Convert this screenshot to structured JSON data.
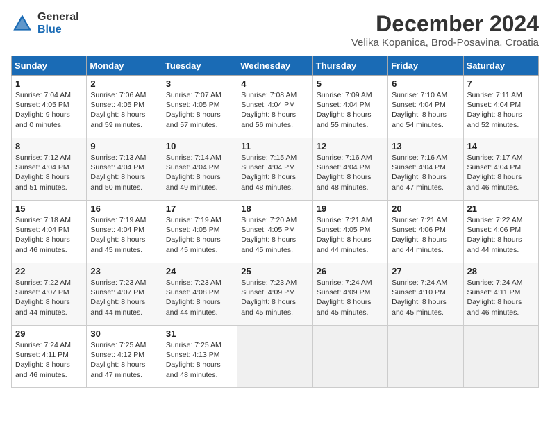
{
  "logo": {
    "general": "General",
    "blue": "Blue"
  },
  "title": "December 2024",
  "subtitle": "Velika Kopanica, Brod-Posavina, Croatia",
  "headers": [
    "Sunday",
    "Monday",
    "Tuesday",
    "Wednesday",
    "Thursday",
    "Friday",
    "Saturday"
  ],
  "weeks": [
    [
      {
        "day": "1",
        "sunrise": "Sunrise: 7:04 AM",
        "sunset": "Sunset: 4:05 PM",
        "daylight": "Daylight: 9 hours and 0 minutes."
      },
      {
        "day": "2",
        "sunrise": "Sunrise: 7:06 AM",
        "sunset": "Sunset: 4:05 PM",
        "daylight": "Daylight: 8 hours and 59 minutes."
      },
      {
        "day": "3",
        "sunrise": "Sunrise: 7:07 AM",
        "sunset": "Sunset: 4:05 PM",
        "daylight": "Daylight: 8 hours and 57 minutes."
      },
      {
        "day": "4",
        "sunrise": "Sunrise: 7:08 AM",
        "sunset": "Sunset: 4:04 PM",
        "daylight": "Daylight: 8 hours and 56 minutes."
      },
      {
        "day": "5",
        "sunrise": "Sunrise: 7:09 AM",
        "sunset": "Sunset: 4:04 PM",
        "daylight": "Daylight: 8 hours and 55 minutes."
      },
      {
        "day": "6",
        "sunrise": "Sunrise: 7:10 AM",
        "sunset": "Sunset: 4:04 PM",
        "daylight": "Daylight: 8 hours and 54 minutes."
      },
      {
        "day": "7",
        "sunrise": "Sunrise: 7:11 AM",
        "sunset": "Sunset: 4:04 PM",
        "daylight": "Daylight: 8 hours and 52 minutes."
      }
    ],
    [
      {
        "day": "8",
        "sunrise": "Sunrise: 7:12 AM",
        "sunset": "Sunset: 4:04 PM",
        "daylight": "Daylight: 8 hours and 51 minutes."
      },
      {
        "day": "9",
        "sunrise": "Sunrise: 7:13 AM",
        "sunset": "Sunset: 4:04 PM",
        "daylight": "Daylight: 8 hours and 50 minutes."
      },
      {
        "day": "10",
        "sunrise": "Sunrise: 7:14 AM",
        "sunset": "Sunset: 4:04 PM",
        "daylight": "Daylight: 8 hours and 49 minutes."
      },
      {
        "day": "11",
        "sunrise": "Sunrise: 7:15 AM",
        "sunset": "Sunset: 4:04 PM",
        "daylight": "Daylight: 8 hours and 48 minutes."
      },
      {
        "day": "12",
        "sunrise": "Sunrise: 7:16 AM",
        "sunset": "Sunset: 4:04 PM",
        "daylight": "Daylight: 8 hours and 48 minutes."
      },
      {
        "day": "13",
        "sunrise": "Sunrise: 7:16 AM",
        "sunset": "Sunset: 4:04 PM",
        "daylight": "Daylight: 8 hours and 47 minutes."
      },
      {
        "day": "14",
        "sunrise": "Sunrise: 7:17 AM",
        "sunset": "Sunset: 4:04 PM",
        "daylight": "Daylight: 8 hours and 46 minutes."
      }
    ],
    [
      {
        "day": "15",
        "sunrise": "Sunrise: 7:18 AM",
        "sunset": "Sunset: 4:04 PM",
        "daylight": "Daylight: 8 hours and 46 minutes."
      },
      {
        "day": "16",
        "sunrise": "Sunrise: 7:19 AM",
        "sunset": "Sunset: 4:04 PM",
        "daylight": "Daylight: 8 hours and 45 minutes."
      },
      {
        "day": "17",
        "sunrise": "Sunrise: 7:19 AM",
        "sunset": "Sunset: 4:05 PM",
        "daylight": "Daylight: 8 hours and 45 minutes."
      },
      {
        "day": "18",
        "sunrise": "Sunrise: 7:20 AM",
        "sunset": "Sunset: 4:05 PM",
        "daylight": "Daylight: 8 hours and 45 minutes."
      },
      {
        "day": "19",
        "sunrise": "Sunrise: 7:21 AM",
        "sunset": "Sunset: 4:05 PM",
        "daylight": "Daylight: 8 hours and 44 minutes."
      },
      {
        "day": "20",
        "sunrise": "Sunrise: 7:21 AM",
        "sunset": "Sunset: 4:06 PM",
        "daylight": "Daylight: 8 hours and 44 minutes."
      },
      {
        "day": "21",
        "sunrise": "Sunrise: 7:22 AM",
        "sunset": "Sunset: 4:06 PM",
        "daylight": "Daylight: 8 hours and 44 minutes."
      }
    ],
    [
      {
        "day": "22",
        "sunrise": "Sunrise: 7:22 AM",
        "sunset": "Sunset: 4:07 PM",
        "daylight": "Daylight: 8 hours and 44 minutes."
      },
      {
        "day": "23",
        "sunrise": "Sunrise: 7:23 AM",
        "sunset": "Sunset: 4:07 PM",
        "daylight": "Daylight: 8 hours and 44 minutes."
      },
      {
        "day": "24",
        "sunrise": "Sunrise: 7:23 AM",
        "sunset": "Sunset: 4:08 PM",
        "daylight": "Daylight: 8 hours and 44 minutes."
      },
      {
        "day": "25",
        "sunrise": "Sunrise: 7:23 AM",
        "sunset": "Sunset: 4:09 PM",
        "daylight": "Daylight: 8 hours and 45 minutes."
      },
      {
        "day": "26",
        "sunrise": "Sunrise: 7:24 AM",
        "sunset": "Sunset: 4:09 PM",
        "daylight": "Daylight: 8 hours and 45 minutes."
      },
      {
        "day": "27",
        "sunrise": "Sunrise: 7:24 AM",
        "sunset": "Sunset: 4:10 PM",
        "daylight": "Daylight: 8 hours and 45 minutes."
      },
      {
        "day": "28",
        "sunrise": "Sunrise: 7:24 AM",
        "sunset": "Sunset: 4:11 PM",
        "daylight": "Daylight: 8 hours and 46 minutes."
      }
    ],
    [
      {
        "day": "29",
        "sunrise": "Sunrise: 7:24 AM",
        "sunset": "Sunset: 4:11 PM",
        "daylight": "Daylight: 8 hours and 46 minutes."
      },
      {
        "day": "30",
        "sunrise": "Sunrise: 7:25 AM",
        "sunset": "Sunset: 4:12 PM",
        "daylight": "Daylight: 8 hours and 47 minutes."
      },
      {
        "day": "31",
        "sunrise": "Sunrise: 7:25 AM",
        "sunset": "Sunset: 4:13 PM",
        "daylight": "Daylight: 8 hours and 48 minutes."
      },
      null,
      null,
      null,
      null
    ]
  ]
}
